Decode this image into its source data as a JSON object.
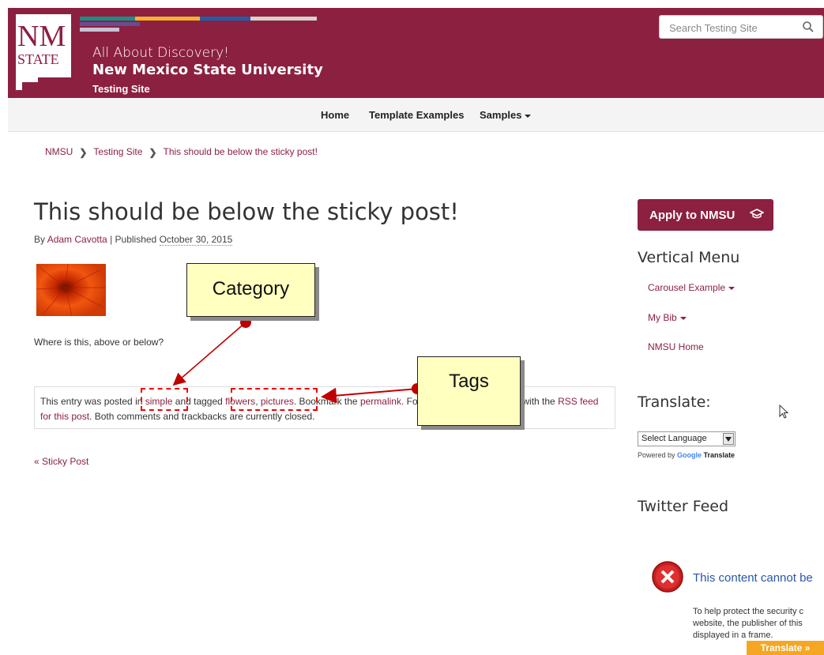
{
  "header": {
    "logo_line1": "NM",
    "logo_line2": "STATE",
    "tagline": "All About Discovery!",
    "university": "New Mexico State University",
    "site": "Testing Site",
    "search_placeholder": "Search Testing Site",
    "brand_color": "#8c2040"
  },
  "nav": {
    "items": [
      {
        "label": "Home"
      },
      {
        "label": "Template Examples"
      },
      {
        "label": "Samples"
      }
    ]
  },
  "breadcrumb": [
    "NMSU",
    "Testing Site",
    "This should be below the sticky post!"
  ],
  "post": {
    "title": "This should be below the sticky post!",
    "by": "By ",
    "author": "Adam Cavotta",
    "published_prefix": " | Published ",
    "date": "October 30, 2015",
    "body": "Where is this, above or below?",
    "entry": {
      "t1": "This entry was posted ",
      "t1b": "in ",
      "category": "simple",
      "t2": " and tagged ",
      "tag1": "flowers",
      "sep": ", ",
      "tag2": "pictures",
      "t3": ". Bookmark the ",
      "permalink": "permalink",
      "t4": ". Follow any comments here with the ",
      "rss": "RSS feed for this post",
      "t5": ". Both comments and trackbacks are currently closed."
    },
    "prev_link": "« Sticky Post"
  },
  "annotations": {
    "category_label": "Category",
    "tags_label": "Tags",
    "arrow_color": "#c00000"
  },
  "sidebar": {
    "apply_label": "Apply to NMSU",
    "vertical_menu_title": "Vertical Menu",
    "menu_items": [
      {
        "label": "Carousel Example",
        "has_dropdown": true
      },
      {
        "label": "My Bib",
        "has_dropdown": true
      },
      {
        "label": "NMSU Home",
        "has_dropdown": false
      }
    ],
    "translate_title": "Translate:",
    "language_select_value": "Select Language",
    "powered_by": "Powered by ",
    "google": "Google",
    "translate_word": "Translate",
    "twitter_title": "Twitter Feed",
    "blocked_title": "This content cannot be",
    "blocked_body": [
      "To help protect the security c",
      "website, the publisher of this",
      "displayed in a frame."
    ],
    "translate_button": "Translate »"
  }
}
